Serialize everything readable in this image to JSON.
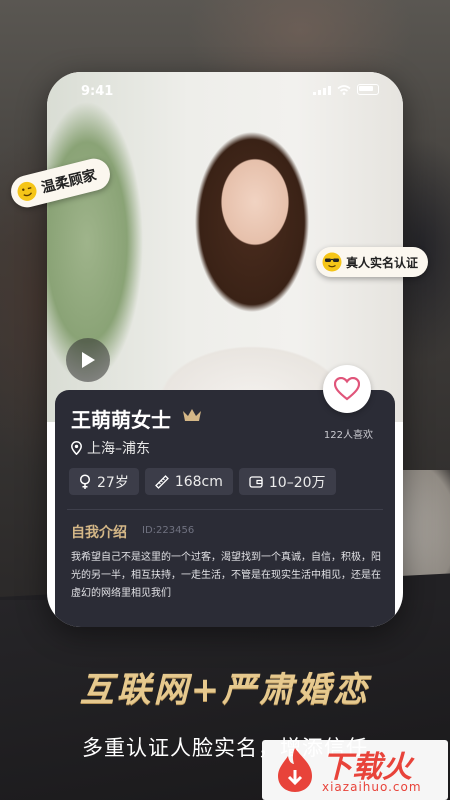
{
  "status_bar": {
    "time": "9:41"
  },
  "badges": {
    "left_label": "温柔顾家",
    "right_label": "真人实名认证"
  },
  "profile": {
    "name": "王萌萌女士",
    "location": "上海–浦东",
    "likes": "122人喜欢",
    "tags": [
      {
        "icon": "female-icon",
        "label": "27岁"
      },
      {
        "icon": "ruler-icon",
        "label": "168cm"
      },
      {
        "icon": "wallet-icon",
        "label": "10–20万"
      }
    ],
    "intro_title": "自我介绍",
    "intro_id": "ID:223456",
    "intro_text": "我希望自己不是这里的一个过客，渴望找到一个真诚，自信，积极，阳光的另一半，相互扶持，一走生活，不管是在现实生活中相见，还是在虚幻的网络里相见我们"
  },
  "promo": {
    "headline": "互联网+严肃婚恋",
    "subline": "多重认证人脸实名，增添信任"
  },
  "watermark": {
    "title": "下载火",
    "url": "xiazaihuo.com"
  },
  "colors": {
    "accent_gold": "#d4b787",
    "card_bg": "#2b2c36",
    "heart_pink": "#e0557a",
    "watermark_red": "#e8433a"
  }
}
